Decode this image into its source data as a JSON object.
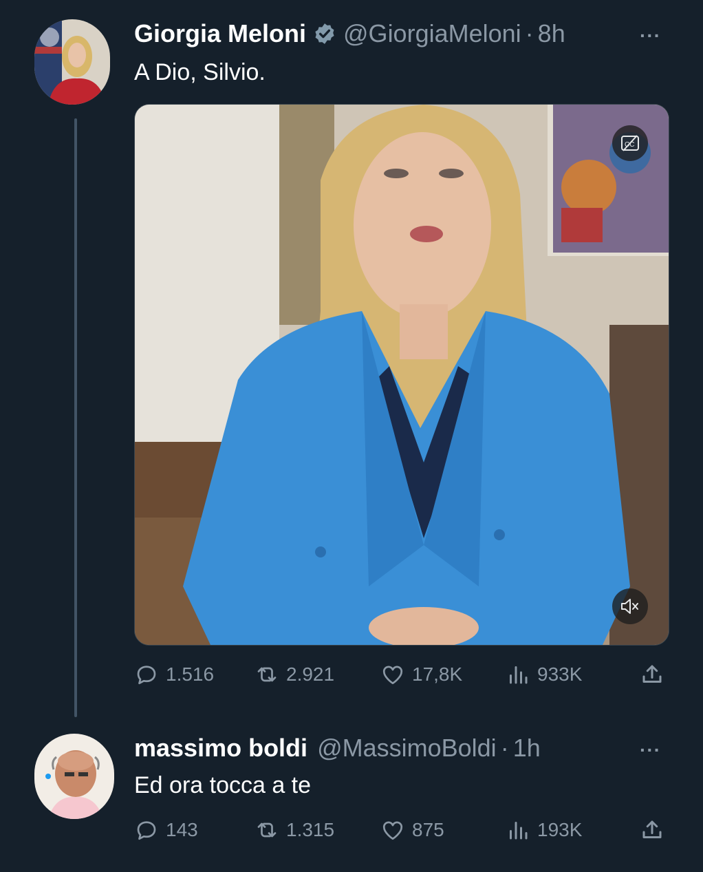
{
  "tweet1": {
    "name": "Giorgia Meloni",
    "handle": "@GiorgiaMeloni",
    "separator": "·",
    "time": "8h",
    "more": "···",
    "text": "A Dio, Silvio.",
    "stats": {
      "replies": "1.516",
      "retweets": "2.921",
      "likes": "17,8K",
      "views": "933K"
    }
  },
  "tweet2": {
    "name": "massimo boldi",
    "handle": "@MassimoBoldi",
    "separator": "·",
    "time": "1h",
    "more": "···",
    "text": "Ed ora tocca a te",
    "stats": {
      "replies": "143",
      "retweets": "1.315",
      "likes": "875",
      "views": "193K"
    }
  },
  "colors": {
    "background": "#15202b",
    "verified": "#829aab",
    "muted": "#8b98a5"
  }
}
